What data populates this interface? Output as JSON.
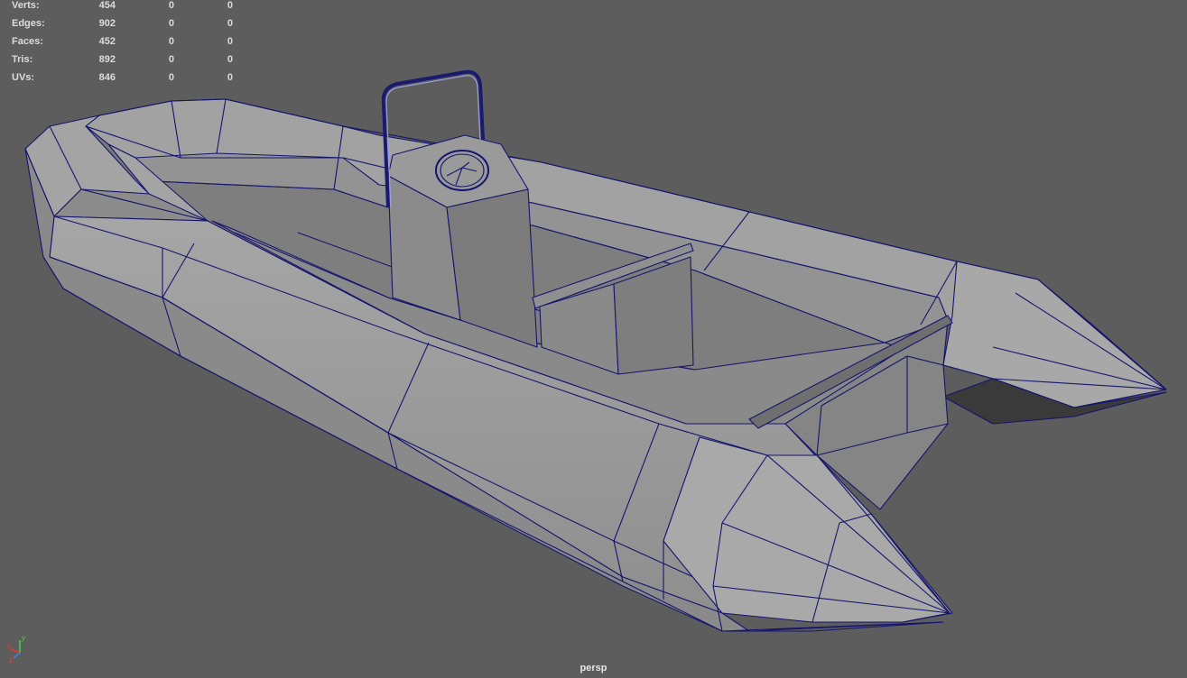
{
  "stats": {
    "rows": [
      {
        "label": "Verts:",
        "values": [
          "454",
          "0",
          "0"
        ]
      },
      {
        "label": "Edges:",
        "values": [
          "902",
          "0",
          "0"
        ]
      },
      {
        "label": "Faces:",
        "values": [
          "452",
          "0",
          "0"
        ]
      },
      {
        "label": "Tris:",
        "values": [
          "892",
          "0",
          "0"
        ]
      },
      {
        "label": "UVs:",
        "values": [
          "846",
          "0",
          "0"
        ]
      }
    ]
  },
  "viewport": {
    "camera": "persp",
    "background_color": "#5d5d5d",
    "wire_color": "#15156e",
    "model": "inflatable-boat"
  },
  "axis": {
    "x_label": "x",
    "y_label": "y",
    "z_label": "z",
    "x_color": "#e23c3c",
    "y_color": "#44d044",
    "z_color": "#4a7de8"
  }
}
